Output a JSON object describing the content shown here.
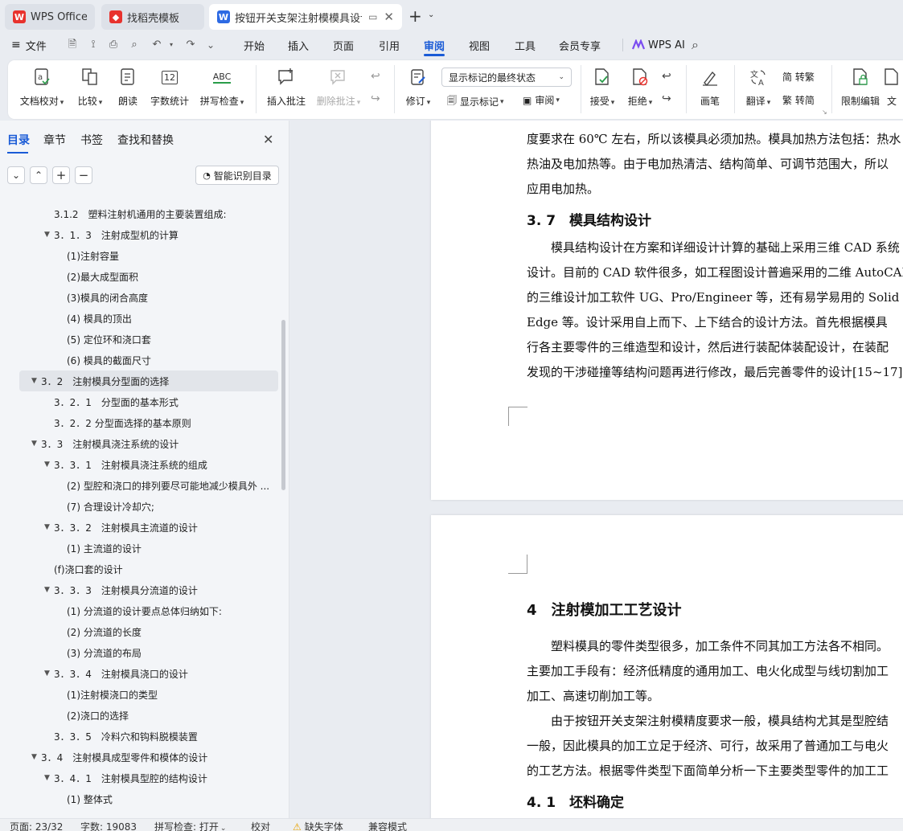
{
  "tabs": [
    {
      "label": "WPS Office"
    },
    {
      "label": "找稻壳模板"
    },
    {
      "label": "按钮开关支架注射模模具设计"
    }
  ],
  "menu": {
    "file": "文件",
    "items": [
      "开始",
      "插入",
      "页面",
      "引用",
      "审阅",
      "视图",
      "工具",
      "会员专享"
    ],
    "active": "审阅",
    "ai": "WPS AI"
  },
  "ribbon": {
    "doc_check": "文档校对",
    "compare": "比较",
    "read_aloud": "朗读",
    "word_count": "字数统计",
    "word_count_icon": "12",
    "spell_check": "拼写检查",
    "spell_icon": "ABC",
    "insert_comment": "插入批注",
    "delete_comment": "删除批注",
    "track_changes": "修订",
    "markup_mode": "显示标记的最终状态",
    "show_markup": "显示标记",
    "review": "审阅",
    "accept": "接受",
    "reject": "拒绝",
    "pen": "画笔",
    "translate": "翻译",
    "to_traditional": "简 转繁",
    "to_simplified": "繁 转简",
    "restrict_edit": "限制编辑",
    "doc_more": "文"
  },
  "sidebar": {
    "tabs": [
      "目录",
      "章节",
      "书签",
      "查找和替换"
    ],
    "active_tab": "目录",
    "smart_toc": "智能识别目录",
    "toc": [
      {
        "text": "3.1.2　塑料注射机通用的主要装置组成:",
        "level": 2,
        "arrow": false
      },
      {
        "text": "3．1．3　注射成型机的计算",
        "level": 2,
        "arrow": true
      },
      {
        "text": "(1)注射容量",
        "level": 3,
        "arrow": false
      },
      {
        "text": "(2)最大成型面积",
        "level": 3,
        "arrow": false
      },
      {
        "text": "(3)模具的闭合高度",
        "level": 3,
        "arrow": false
      },
      {
        "text": "(4) 模具的顶出",
        "level": 3,
        "arrow": false
      },
      {
        "text": "(5) 定位环和浇口套",
        "level": 3,
        "arrow": false
      },
      {
        "text": "(6) 模具的截面尺寸",
        "level": 3,
        "arrow": false
      },
      {
        "text": "3．2　注射模具分型面的选择",
        "level": 1,
        "arrow": true,
        "selected": true
      },
      {
        "text": "3．2．1　分型面的基本形式",
        "level": 2,
        "arrow": false
      },
      {
        "text": "3．2．2 分型面选择的基本原则",
        "level": 2,
        "arrow": false
      },
      {
        "text": "3．3　注射模具浇注系统的设计",
        "level": 1,
        "arrow": true
      },
      {
        "text": "3．3．1　注射模具浇注系统的组成",
        "level": 2,
        "arrow": true
      },
      {
        "text": "(2) 型腔和浇口的排列要尽可能地减少模具外 ...",
        "level": 3,
        "arrow": false
      },
      {
        "text": "(7) 合理设计冷却穴;",
        "level": 3,
        "arrow": false
      },
      {
        "text": "3．3．2　注射模具主流道的设计",
        "level": 2,
        "arrow": true
      },
      {
        "text": "(1) 主流道的设计",
        "level": 3,
        "arrow": false
      },
      {
        "text": "(f)浇口套的设计",
        "level": 2,
        "arrow": false
      },
      {
        "text": "3．3．3　注射模具分流道的设计",
        "level": 2,
        "arrow": true
      },
      {
        "text": "(1) 分流道的设计要点总体归纳如下:",
        "level": 3,
        "arrow": false
      },
      {
        "text": "(2) 分流道的长度",
        "level": 3,
        "arrow": false
      },
      {
        "text": "(3) 分流道的布局",
        "level": 3,
        "arrow": false
      },
      {
        "text": "3．3．4　注射模具浇口的设计",
        "level": 2,
        "arrow": true
      },
      {
        "text": "(1)注射模浇口的类型",
        "level": 3,
        "arrow": false
      },
      {
        "text": "(2)浇口的选择",
        "level": 3,
        "arrow": false
      },
      {
        "text": "3．3．5　冷料穴和钩料脱模装置",
        "level": 2,
        "arrow": false
      },
      {
        "text": "3．4　注射模具成型零件和模体的设计",
        "level": 1,
        "arrow": true
      },
      {
        "text": "3．4．1　注射模具型腔的结构设计",
        "level": 2,
        "arrow": true
      },
      {
        "text": "(1) 整体式",
        "level": 3,
        "arrow": false
      }
    ]
  },
  "document": {
    "page1": {
      "lines": [
        "度要求在 60℃ 左右，所以该模具必须加热。模具加热方法包括：热水",
        "热油及电加热等。由于电加热清洁、结构简单、可调节范围大，所以",
        "应用电加热。"
      ],
      "heading": "3. 7　模具结构设计",
      "para": [
        "　　模具结构设计在方案和详细设计计算的基础上采用三维 CAD 系统",
        "设计。目前的 CAD 软件很多，如工程图设计普遍采用的二维 AutoCAD",
        "的三维设计加工软件 UG、Pro/Engineer 等，还有易学易用的 Solid",
        "Edge 等。设计采用自上而下、上下结合的设计方法。首先根据模具",
        "行各主要零件的三维造型和设计，然后进行装配体装配设计，在装配",
        "发现的干涉碰撞等结构问题再进行修改，最后完善零件的设计[15~17]。"
      ]
    },
    "page2": {
      "chapter": "4　注射模加工工艺设计",
      "para1": [
        "　　塑料模具的零件类型很多，加工条件不同其加工方法各不相同。",
        "主要加工手段有：经济低精度的通用加工、电火化成型与线切割加工",
        "加工、高速切削加工等。"
      ],
      "para2": [
        "　　由于按钮开关支架注射模精度要求一般，模具结构尤其是型腔结",
        "一般，因此模具的加工立足于经济、可行，故采用了普通加工与电火",
        "的工艺方法。根据零件类型下面简单分析一下主要类型零件的加工工"
      ],
      "heading": "4. 1　坯料确定"
    }
  },
  "status": {
    "page": "页面: 23/32",
    "words": "字数: 19083",
    "spell": "拼写检查: 打开",
    "proof": "校对",
    "missing_font": "缺失字体",
    "compat": "兼容模式"
  },
  "colors": {
    "accent": "#1a5bd6",
    "wps_red": "#e8322d",
    "doc_blue": "#2d6ae3"
  }
}
